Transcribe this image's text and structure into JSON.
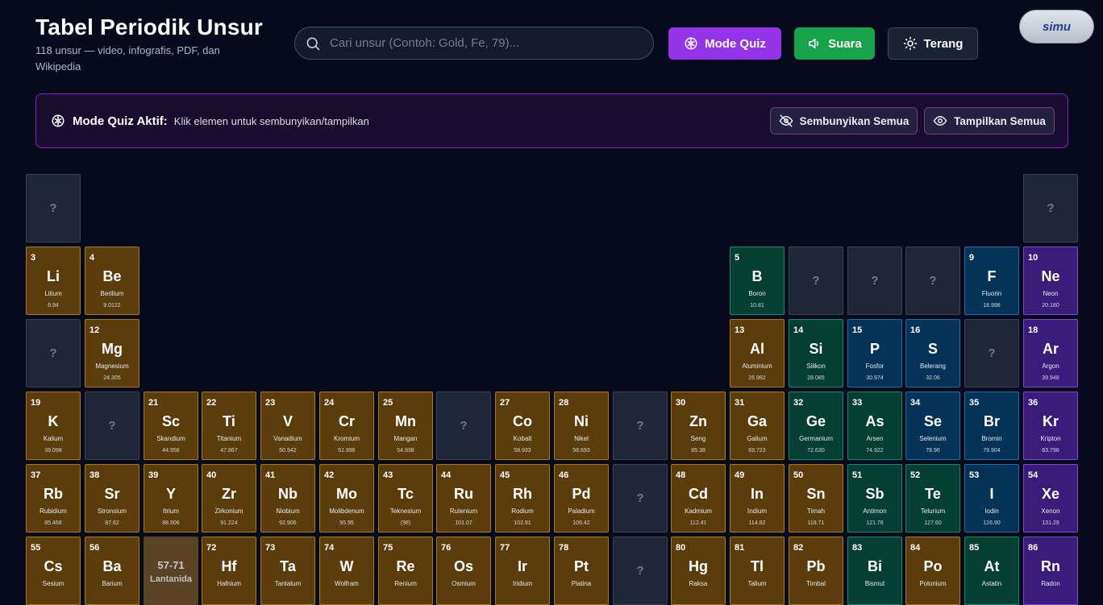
{
  "header": {
    "title": "Tabel Periodik Unsur",
    "subtitle": "118 unsur — video, infografis, PDF, dan Wikipedia",
    "search_placeholder": "Cari unsur (Contoh: Gold, Fe, 79)...",
    "btn_quiz": "Mode Quiz",
    "btn_sound": "Suara",
    "btn_theme": "Terang",
    "logo_text": "simu"
  },
  "quiz_banner": {
    "title": "Mode Quiz Aktif:",
    "description": "Klik elemen untuk sembunyikan/tampilkan",
    "hide_all": "Sembunyikan Semua",
    "show_all": "Tampilkan Semua"
  },
  "colors": {
    "metal": "#5b3d0c",
    "metalloid": "#053f34",
    "nonmetal": "#053358",
    "noble_gas": "#3a1d7a",
    "hidden": "#1f2736",
    "quiz_accent": "#9333ea",
    "sound_accent": "#16a34a"
  },
  "hidden_mark": "?",
  "elements": [
    {
      "hidden": true,
      "row": 1,
      "col": 1
    },
    {
      "hidden": true,
      "row": 1,
      "col": 18
    },
    {
      "row": 2,
      "col": 1,
      "num": "3",
      "sym": "Li",
      "name": "Litium",
      "mass": "6.94",
      "cat": "metal"
    },
    {
      "row": 2,
      "col": 2,
      "num": "4",
      "sym": "Be",
      "name": "Berilium",
      "mass": "9.0122",
      "cat": "metal"
    },
    {
      "row": 2,
      "col": 13,
      "num": "5",
      "sym": "B",
      "name": "Boron",
      "mass": "10.81",
      "cat": "metalloid"
    },
    {
      "hidden": true,
      "row": 2,
      "col": 14
    },
    {
      "hidden": true,
      "row": 2,
      "col": 15
    },
    {
      "hidden": true,
      "row": 2,
      "col": 16
    },
    {
      "row": 2,
      "col": 17,
      "num": "9",
      "sym": "F",
      "name": "Fluorin",
      "mass": "18.998",
      "cat": "nonmetal"
    },
    {
      "row": 2,
      "col": 18,
      "num": "10",
      "sym": "Ne",
      "name": "Neon",
      "mass": "20.180",
      "cat": "noble"
    },
    {
      "hidden": true,
      "row": 3,
      "col": 1
    },
    {
      "row": 3,
      "col": 2,
      "num": "12",
      "sym": "Mg",
      "name": "Magnesium",
      "mass": "24.305",
      "cat": "metal"
    },
    {
      "row": 3,
      "col": 13,
      "num": "13",
      "sym": "Al",
      "name": "Aluminium",
      "mass": "26.982",
      "cat": "metal"
    },
    {
      "row": 3,
      "col": 14,
      "num": "14",
      "sym": "Si",
      "name": "Silikon",
      "mass": "28.085",
      "cat": "metalloid"
    },
    {
      "row": 3,
      "col": 15,
      "num": "15",
      "sym": "P",
      "name": "Fosfor",
      "mass": "30.974",
      "cat": "nonmetal"
    },
    {
      "row": 3,
      "col": 16,
      "num": "16",
      "sym": "S",
      "name": "Belerang",
      "mass": "32.06",
      "cat": "nonmetal"
    },
    {
      "hidden": true,
      "row": 3,
      "col": 17
    },
    {
      "row": 3,
      "col": 18,
      "num": "18",
      "sym": "Ar",
      "name": "Argon",
      "mass": "39.948",
      "cat": "noble"
    },
    {
      "row": 4,
      "col": 1,
      "num": "19",
      "sym": "K",
      "name": "Kalium",
      "mass": "39.098",
      "cat": "metal"
    },
    {
      "hidden": true,
      "row": 4,
      "col": 2
    },
    {
      "row": 4,
      "col": 3,
      "num": "21",
      "sym": "Sc",
      "name": "Skandium",
      "mass": "44.956",
      "cat": "metal"
    },
    {
      "row": 4,
      "col": 4,
      "num": "22",
      "sym": "Ti",
      "name": "Titanium",
      "mass": "47.867",
      "cat": "metal"
    },
    {
      "row": 4,
      "col": 5,
      "num": "23",
      "sym": "V",
      "name": "Vanadium",
      "mass": "50.942",
      "cat": "metal"
    },
    {
      "row": 4,
      "col": 6,
      "num": "24",
      "sym": "Cr",
      "name": "Kromium",
      "mass": "51.996",
      "cat": "metal"
    },
    {
      "row": 4,
      "col": 7,
      "num": "25",
      "sym": "Mn",
      "name": "Mangan",
      "mass": "54.938",
      "cat": "metal"
    },
    {
      "hidden": true,
      "row": 4,
      "col": 8
    },
    {
      "row": 4,
      "col": 9,
      "num": "27",
      "sym": "Co",
      "name": "Kobalt",
      "mass": "58.933",
      "cat": "metal"
    },
    {
      "row": 4,
      "col": 10,
      "num": "28",
      "sym": "Ni",
      "name": "Nikel",
      "mass": "58.693",
      "cat": "metal"
    },
    {
      "hidden": true,
      "row": 4,
      "col": 11
    },
    {
      "row": 4,
      "col": 12,
      "num": "30",
      "sym": "Zn",
      "name": "Seng",
      "mass": "65.38",
      "cat": "metal"
    },
    {
      "row": 4,
      "col": 13,
      "num": "31",
      "sym": "Ga",
      "name": "Galium",
      "mass": "69.723",
      "cat": "metal"
    },
    {
      "row": 4,
      "col": 14,
      "num": "32",
      "sym": "Ge",
      "name": "Germanium",
      "mass": "72.630",
      "cat": "metalloid"
    },
    {
      "row": 4,
      "col": 15,
      "num": "33",
      "sym": "As",
      "name": "Arsen",
      "mass": "74.922",
      "cat": "metalloid"
    },
    {
      "row": 4,
      "col": 16,
      "num": "34",
      "sym": "Se",
      "name": "Selenium",
      "mass": "78.96",
      "cat": "nonmetal"
    },
    {
      "row": 4,
      "col": 17,
      "num": "35",
      "sym": "Br",
      "name": "Bromin",
      "mass": "79.904",
      "cat": "nonmetal"
    },
    {
      "row": 4,
      "col": 18,
      "num": "36",
      "sym": "Kr",
      "name": "Kripton",
      "mass": "83.798",
      "cat": "noble"
    },
    {
      "row": 5,
      "col": 1,
      "num": "37",
      "sym": "Rb",
      "name": "Rubidium",
      "mass": "85.468",
      "cat": "metal"
    },
    {
      "row": 5,
      "col": 2,
      "num": "38",
      "sym": "Sr",
      "name": "Stronsium",
      "mass": "87.62",
      "cat": "metal"
    },
    {
      "row": 5,
      "col": 3,
      "num": "39",
      "sym": "Y",
      "name": "Itrium",
      "mass": "88.906",
      "cat": "metal"
    },
    {
      "row": 5,
      "col": 4,
      "num": "40",
      "sym": "Zr",
      "name": "Zirkonium",
      "mass": "91.224",
      "cat": "metal"
    },
    {
      "row": 5,
      "col": 5,
      "num": "41",
      "sym": "Nb",
      "name": "Niobium",
      "mass": "92.906",
      "cat": "metal"
    },
    {
      "row": 5,
      "col": 6,
      "num": "42",
      "sym": "Mo",
      "name": "Molibdenum",
      "mass": "95.95",
      "cat": "metal"
    },
    {
      "row": 5,
      "col": 7,
      "num": "43",
      "sym": "Tc",
      "name": "Teknesium",
      "mass": "(98)",
      "cat": "metal"
    },
    {
      "row": 5,
      "col": 8,
      "num": "44",
      "sym": "Ru",
      "name": "Rutenium",
      "mass": "101.07",
      "cat": "metal"
    },
    {
      "row": 5,
      "col": 9,
      "num": "45",
      "sym": "Rh",
      "name": "Rodium",
      "mass": "102.91",
      "cat": "metal"
    },
    {
      "row": 5,
      "col": 10,
      "num": "46",
      "sym": "Pd",
      "name": "Paladium",
      "mass": "106.42",
      "cat": "metal"
    },
    {
      "hidden": true,
      "row": 5,
      "col": 11
    },
    {
      "row": 5,
      "col": 12,
      "num": "48",
      "sym": "Cd",
      "name": "Kadmium",
      "mass": "112.41",
      "cat": "metal"
    },
    {
      "row": 5,
      "col": 13,
      "num": "49",
      "sym": "In",
      "name": "Indium",
      "mass": "114.82",
      "cat": "metal"
    },
    {
      "row": 5,
      "col": 14,
      "num": "50",
      "sym": "Sn",
      "name": "Timah",
      "mass": "118.71",
      "cat": "metal"
    },
    {
      "row": 5,
      "col": 15,
      "num": "51",
      "sym": "Sb",
      "name": "Antimon",
      "mass": "121.76",
      "cat": "metalloid"
    },
    {
      "row": 5,
      "col": 16,
      "num": "52",
      "sym": "Te",
      "name": "Telurium",
      "mass": "127.60",
      "cat": "metalloid"
    },
    {
      "row": 5,
      "col": 17,
      "num": "53",
      "sym": "I",
      "name": "Iodin",
      "mass": "126.90",
      "cat": "nonmetal"
    },
    {
      "row": 5,
      "col": 18,
      "num": "54",
      "sym": "Xe",
      "name": "Xenon",
      "mass": "131.29",
      "cat": "noble"
    },
    {
      "row": 6,
      "col": 1,
      "num": "55",
      "sym": "Cs",
      "name": "Sesium",
      "mass": "",
      "cat": "metal"
    },
    {
      "row": 6,
      "col": 2,
      "num": "56",
      "sym": "Ba",
      "name": "Barium",
      "mass": "",
      "cat": "metal"
    },
    {
      "row": 6,
      "col": 3,
      "range": true,
      "range_num": "57-71",
      "range_label": "Lantanida"
    },
    {
      "row": 6,
      "col": 4,
      "num": "72",
      "sym": "Hf",
      "name": "Hafnium",
      "mass": "",
      "cat": "metal"
    },
    {
      "row": 6,
      "col": 5,
      "num": "73",
      "sym": "Ta",
      "name": "Tantalum",
      "mass": "",
      "cat": "metal"
    },
    {
      "row": 6,
      "col": 6,
      "num": "74",
      "sym": "W",
      "name": "Wolfram",
      "mass": "",
      "cat": "metal"
    },
    {
      "row": 6,
      "col": 7,
      "num": "75",
      "sym": "Re",
      "name": "Renium",
      "mass": "",
      "cat": "metal"
    },
    {
      "row": 6,
      "col": 8,
      "num": "76",
      "sym": "Os",
      "name": "Osmium",
      "mass": "",
      "cat": "metal"
    },
    {
      "row": 6,
      "col": 9,
      "num": "77",
      "sym": "Ir",
      "name": "Iridium",
      "mass": "",
      "cat": "metal"
    },
    {
      "row": 6,
      "col": 10,
      "num": "78",
      "sym": "Pt",
      "name": "Platina",
      "mass": "",
      "cat": "metal"
    },
    {
      "hidden": true,
      "row": 6,
      "col": 11
    },
    {
      "row": 6,
      "col": 12,
      "num": "80",
      "sym": "Hg",
      "name": "Raksa",
      "mass": "",
      "cat": "metal"
    },
    {
      "row": 6,
      "col": 13,
      "num": "81",
      "sym": "Tl",
      "name": "Talium",
      "mass": "",
      "cat": "metal"
    },
    {
      "row": 6,
      "col": 14,
      "num": "82",
      "sym": "Pb",
      "name": "Timbal",
      "mass": "",
      "cat": "metal"
    },
    {
      "row": 6,
      "col": 15,
      "num": "83",
      "sym": "Bi",
      "name": "Bismut",
      "mass": "",
      "cat": "metalloid"
    },
    {
      "row": 6,
      "col": 16,
      "num": "84",
      "sym": "Po",
      "name": "Polonium",
      "mass": "",
      "cat": "metal"
    },
    {
      "row": 6,
      "col": 17,
      "num": "85",
      "sym": "At",
      "name": "Astatin",
      "mass": "",
      "cat": "metalloid"
    },
    {
      "row": 6,
      "col": 18,
      "num": "86",
      "sym": "Rn",
      "name": "Radon",
      "mass": "",
      "cat": "noble"
    }
  ]
}
